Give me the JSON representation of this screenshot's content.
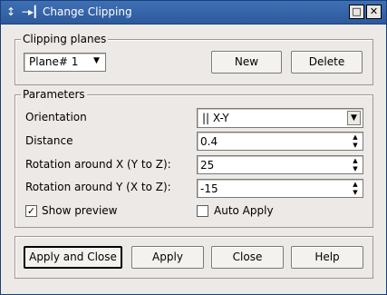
{
  "window": {
    "title": "Change Clipping",
    "controls": [
      "restore-icon",
      "close-icon"
    ]
  },
  "clipping": {
    "group_title": "Clipping planes",
    "plane_selected": "Plane# 1",
    "new_label": "New",
    "delete_label": "Delete"
  },
  "params": {
    "group_title": "Parameters",
    "orientation_label": "Orientation",
    "orientation_value": "|| X-Y",
    "distance_label": "Distance",
    "distance_value": "0.4",
    "rot_x_label": "Rotation around X (Y to Z):",
    "rot_x_value": "25",
    "rot_y_label": "Rotation around Y (X to Z):",
    "rot_y_value": "-15",
    "show_preview_label": "Show preview",
    "show_preview_checked": true,
    "auto_apply_label": "Auto Apply",
    "auto_apply_checked": false
  },
  "footer": {
    "apply_close": "Apply and Close",
    "apply": "Apply",
    "close": "Close",
    "help": "Help"
  }
}
